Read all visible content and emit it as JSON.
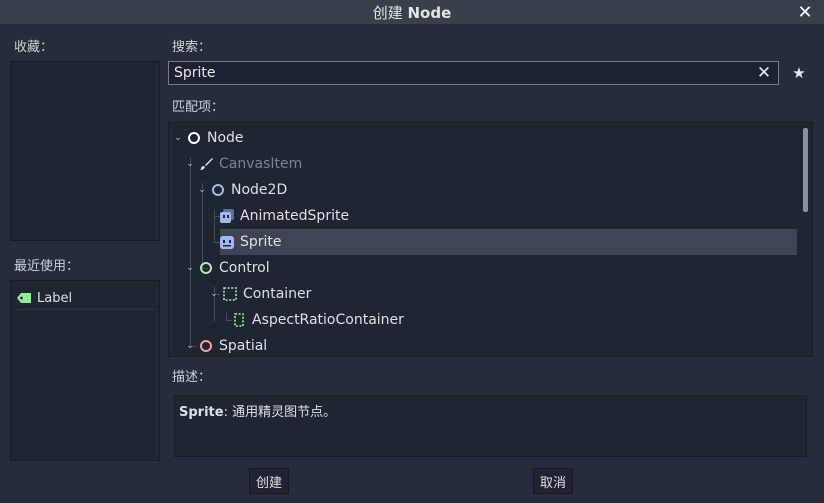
{
  "dialog": {
    "title_prefix": "创建 ",
    "title_node": "Node"
  },
  "left": {
    "favorites_label": "收藏：",
    "recent_label": "最近使用：",
    "recent_items": [
      {
        "label": "Label",
        "icon": "label-tag-icon"
      }
    ]
  },
  "search": {
    "label": "搜索：",
    "value": "Sprite"
  },
  "matches": {
    "label": "匹配项：",
    "items": [
      {
        "label": "Node",
        "icon": "node-ring-icon",
        "expanded": true
      },
      {
        "label": "CanvasItem",
        "icon": "brush-icon",
        "expanded": true,
        "dimmed": true
      },
      {
        "label": "Node2D",
        "icon": "node2d-ring-icon",
        "expanded": true
      },
      {
        "label": "AnimatedSprite",
        "icon": "animated-sprite-icon"
      },
      {
        "label": "Sprite",
        "icon": "sprite-icon",
        "selected": true
      },
      {
        "label": "Control",
        "icon": "control-ring-icon",
        "expanded": true
      },
      {
        "label": "Container",
        "icon": "container-icon",
        "expanded": true
      },
      {
        "label": "AspectRatioContainer",
        "icon": "aspect-ratio-container-icon"
      },
      {
        "label": "Spatial",
        "icon": "spatial-ring-icon",
        "expanded": true
      }
    ]
  },
  "description": {
    "label": "描述：",
    "class_name": "Sprite",
    "text": ": 通用精灵图节点。"
  },
  "buttons": {
    "create": "创建",
    "cancel": "取消"
  },
  "colors": {
    "node2d": "#a5b7f3",
    "control": "#a5efac",
    "spatial": "#fc9c9c",
    "label_tag": "#8eef97"
  }
}
